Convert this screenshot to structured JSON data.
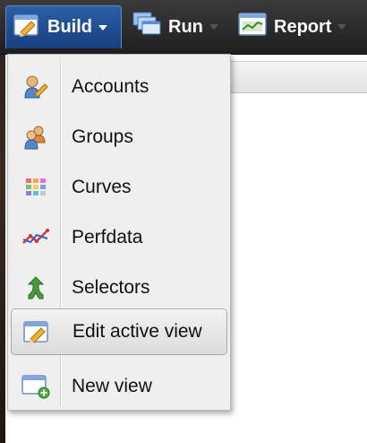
{
  "toolbar": {
    "buttons": [
      {
        "label": "Build",
        "icon": "edit-view-icon",
        "active": true
      },
      {
        "label": "Run",
        "icon": "stacked-windows-icon",
        "active": false
      },
      {
        "label": "Report",
        "icon": "chart-window-icon",
        "active": false
      }
    ]
  },
  "menu": {
    "items": [
      {
        "label": "Accounts",
        "icon": "users-icon"
      },
      {
        "label": "Groups",
        "icon": "group-icon"
      },
      {
        "label": "Curves",
        "icon": "color-grid-icon"
      },
      {
        "label": "Perfdata",
        "icon": "line-chart-icon"
      },
      {
        "label": "Selectors",
        "icon": "branch-arrow-icon"
      },
      {
        "label": "Edit active view",
        "icon": "edit-view-icon",
        "highlighted": true
      },
      {
        "label": "New view",
        "icon": "new-window-icon"
      }
    ]
  },
  "colors": {
    "toolbar_bg": "#2a2a2a",
    "active_button_bg": "#2352a0",
    "menu_bg": "#efefef",
    "highlight_border": "#a9a9a9"
  }
}
